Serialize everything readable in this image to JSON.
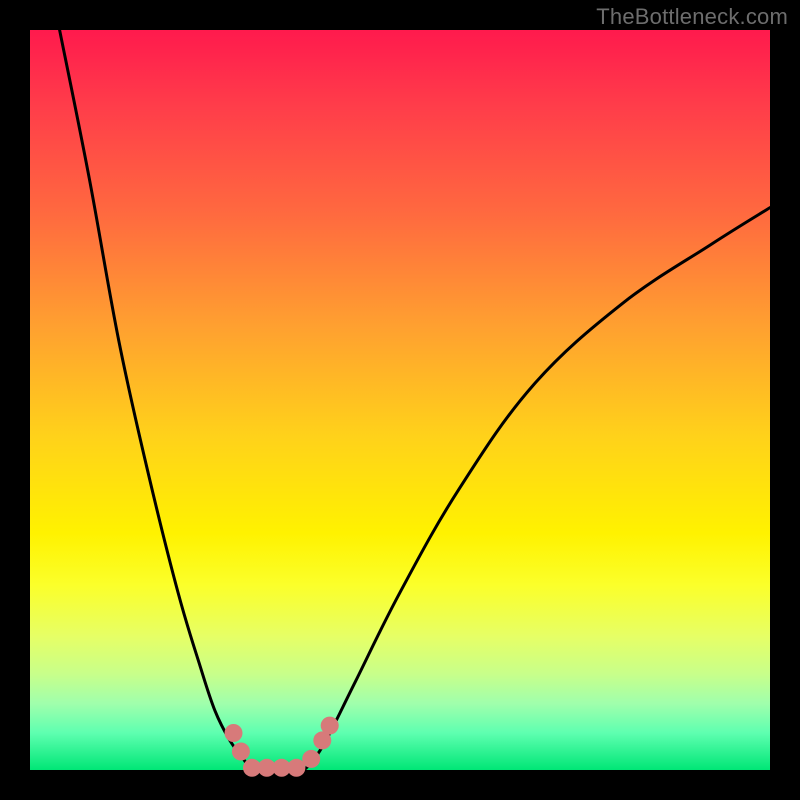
{
  "watermark": "TheBottleneck.com",
  "chart_data": {
    "type": "line",
    "title": "",
    "xlabel": "",
    "ylabel": "",
    "xlim": [
      0,
      100
    ],
    "ylim": [
      0,
      100
    ],
    "grid": false,
    "legend": false,
    "series": [
      {
        "name": "left-curve",
        "color": "#000000",
        "x": [
          4,
          8,
          12,
          16,
          20,
          23,
          25,
          27,
          28.5,
          29.5,
          30
        ],
        "y": [
          100,
          80,
          58,
          40,
          24,
          14,
          8,
          4,
          2,
          0.5,
          0
        ]
      },
      {
        "name": "right-curve",
        "color": "#000000",
        "x": [
          37,
          38,
          40,
          44,
          50,
          58,
          68,
          80,
          92,
          100
        ],
        "y": [
          0,
          1,
          4,
          12,
          24,
          38,
          52,
          63,
          71,
          76
        ]
      },
      {
        "name": "floor",
        "color": "#000000",
        "x": [
          30,
          37
        ],
        "y": [
          0,
          0
        ]
      }
    ],
    "annotations": [
      {
        "name": "marker-band",
        "type": "scatter-band",
        "color": "#d77a7a",
        "points": [
          {
            "x": 27.5,
            "y": 5.0
          },
          {
            "x": 28.5,
            "y": 2.5
          },
          {
            "x": 30.0,
            "y": 0.3
          },
          {
            "x": 32.0,
            "y": 0.3
          },
          {
            "x": 34.0,
            "y": 0.3
          },
          {
            "x": 36.0,
            "y": 0.3
          },
          {
            "x": 38.0,
            "y": 1.5
          },
          {
            "x": 39.5,
            "y": 4.0
          },
          {
            "x": 40.5,
            "y": 6.0
          }
        ]
      }
    ]
  }
}
